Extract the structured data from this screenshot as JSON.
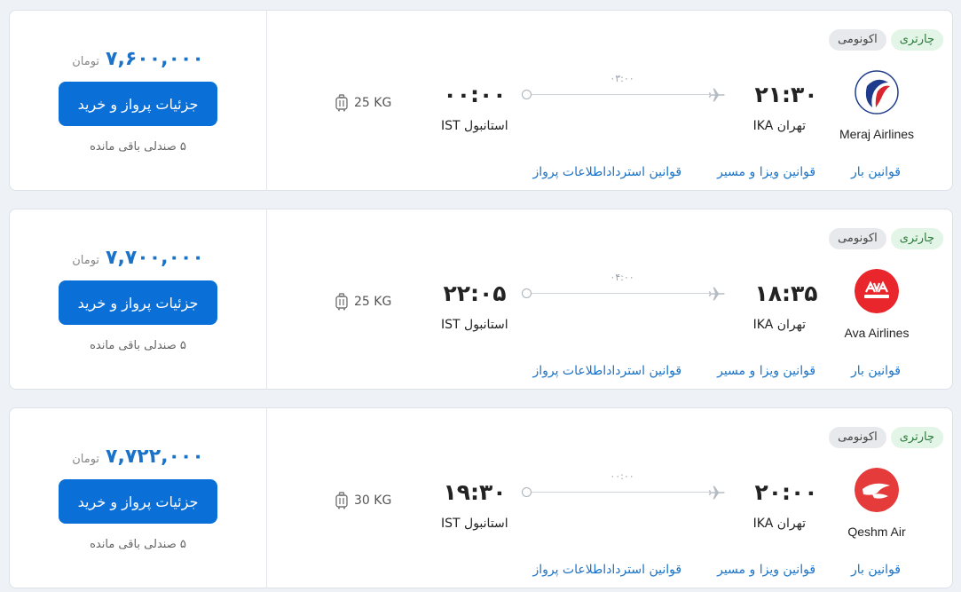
{
  "labels": {
    "charter": "چارتری",
    "economy": "اکونومی",
    "currency": "تومان",
    "buy_button": "جزئیات پرواز و خرید",
    "link_flight_info": "اطلاعات پرواز",
    "link_refund": "قوانین استرداد",
    "link_visa": "قوانین ویزا و مسیر",
    "link_baggage": "قوانین بار"
  },
  "colors": {
    "accent": "#0a6fd6",
    "link": "#1a73c8",
    "charter_bg": "#e3f5e6",
    "meraj": "#1f3c8c",
    "ava": "#e8262b",
    "qeshm": "#e53b3b"
  },
  "flights": [
    {
      "airline": "Meraj Airlines",
      "logo_icon": "meraj-airlines-logo",
      "dep_time": "۲۱:۳۰",
      "dep_city": "تهران IKA",
      "arr_time": "۰۰:۰۰",
      "arr_city": "استانبول IST",
      "duration": "۰۳:۰۰",
      "baggage": "25 KG",
      "price": "۷,۶۰۰,۰۰۰",
      "seats": "۵ صندلی باقی مانده"
    },
    {
      "airline": "Ava Airlines",
      "logo_icon": "ava-airlines-logo",
      "dep_time": "۱۸:۳۵",
      "dep_city": "تهران IKA",
      "arr_time": "۲۲:۰۵",
      "arr_city": "استانبول IST",
      "duration": "۰۴:۰۰",
      "baggage": "25 KG",
      "price": "۷,۷۰۰,۰۰۰",
      "seats": "۵ صندلی باقی مانده"
    },
    {
      "airline": "Qeshm Air",
      "logo_icon": "qeshm-air-logo",
      "dep_time": "۲۰:۰۰",
      "dep_city": "تهران IKA",
      "arr_time": "۱۹:۳۰",
      "arr_city": "استانبول IST",
      "duration": "۰۰:۰۰",
      "baggage": "30 KG",
      "price": "۷,۷۲۲,۰۰۰",
      "seats": "۵ صندلی باقی مانده"
    }
  ]
}
